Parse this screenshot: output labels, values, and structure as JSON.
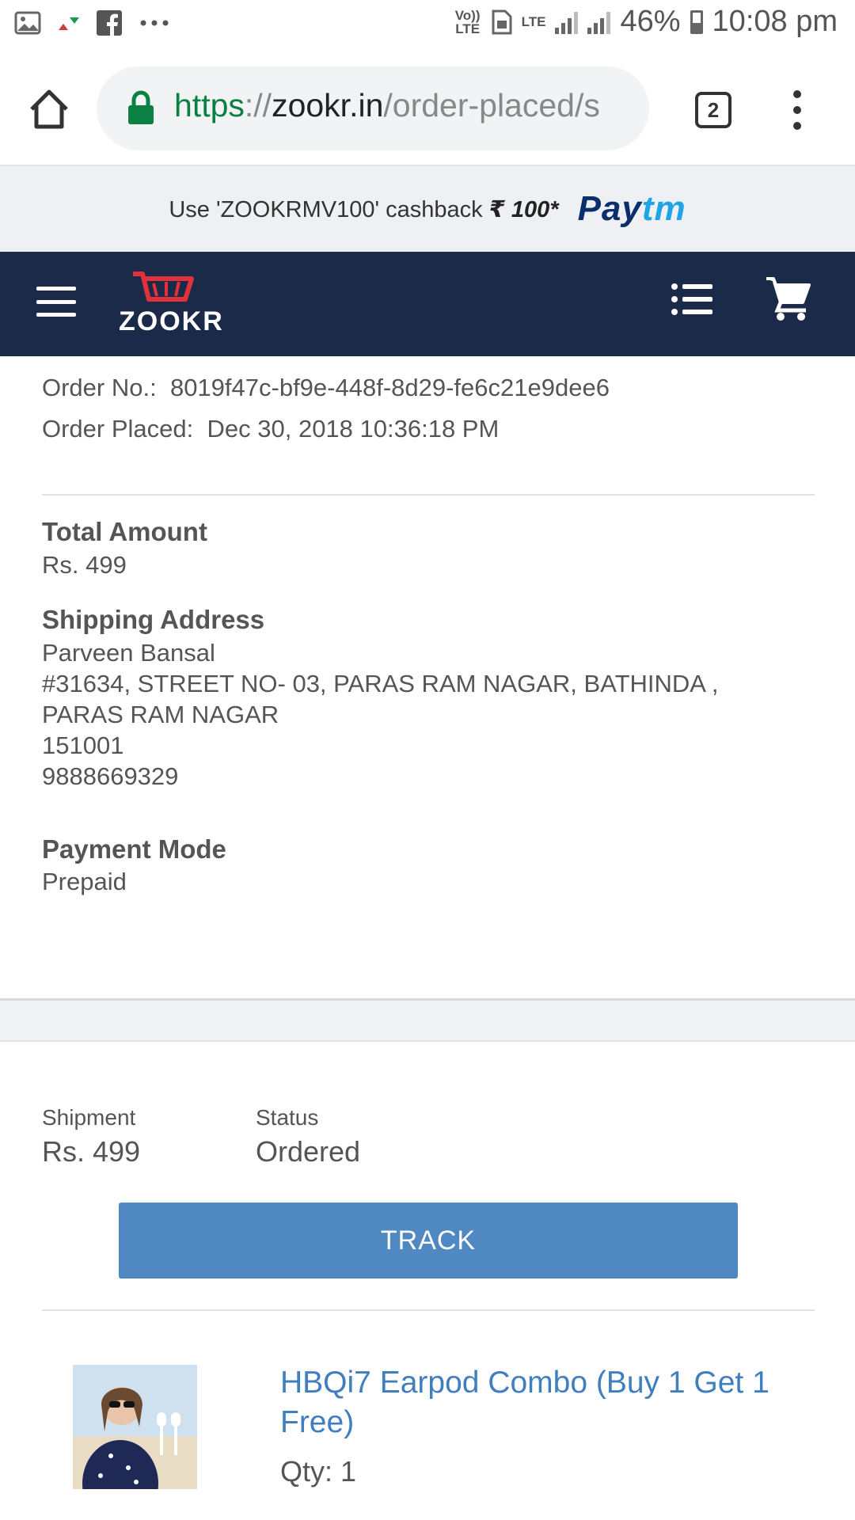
{
  "status_bar": {
    "volte": "Vo)) LTE",
    "lte": "LTE",
    "battery": "46%",
    "time": "10:08 pm"
  },
  "browser": {
    "url_scheme": "https",
    "url_sep": "://",
    "url_host": "zookr.in",
    "url_path": "/order-placed/s",
    "tab_count": "2"
  },
  "promo": {
    "text": "Use 'ZOOKRMV100' cashback",
    "amount": "₹ 100*",
    "brand_pay": "Pay",
    "brand_tm": "tm"
  },
  "header": {
    "logo_text": "ZOOKR"
  },
  "order": {
    "number_label": "Order No.:",
    "number_value": "8019f47c-bf9e-448f-8d29-fe6c21e9dee6",
    "placed_label": "Order Placed:",
    "placed_value": "Dec 30, 2018 10:36:18 PM"
  },
  "total": {
    "title": "Total Amount",
    "value": "Rs. 499"
  },
  "shipping": {
    "title": "Shipping Address",
    "name": "Parveen Bansal",
    "line1": "#31634, STREET NO- 03, PARAS RAM NAGAR, BATHINDA ,",
    "line2": "PARAS RAM NAGAR",
    "pin": "151001",
    "phone": "9888669329"
  },
  "payment": {
    "title": "Payment Mode",
    "value": "Prepaid"
  },
  "shipment": {
    "label": "Shipment",
    "value": "Rs. 499",
    "status_label": "Status",
    "status_value": "Ordered",
    "track_label": "TRACK"
  },
  "product": {
    "title": "HBQi7 Earpod Combo (Buy 1 Get 1 Free)",
    "qty": "Qty: 1"
  },
  "colors": {
    "header_bg": "#1b2a48",
    "track_button": "#5088c2",
    "product_link": "#3f7fbf",
    "lock_green": "#0b8043",
    "logo_red": "#e0323a"
  }
}
